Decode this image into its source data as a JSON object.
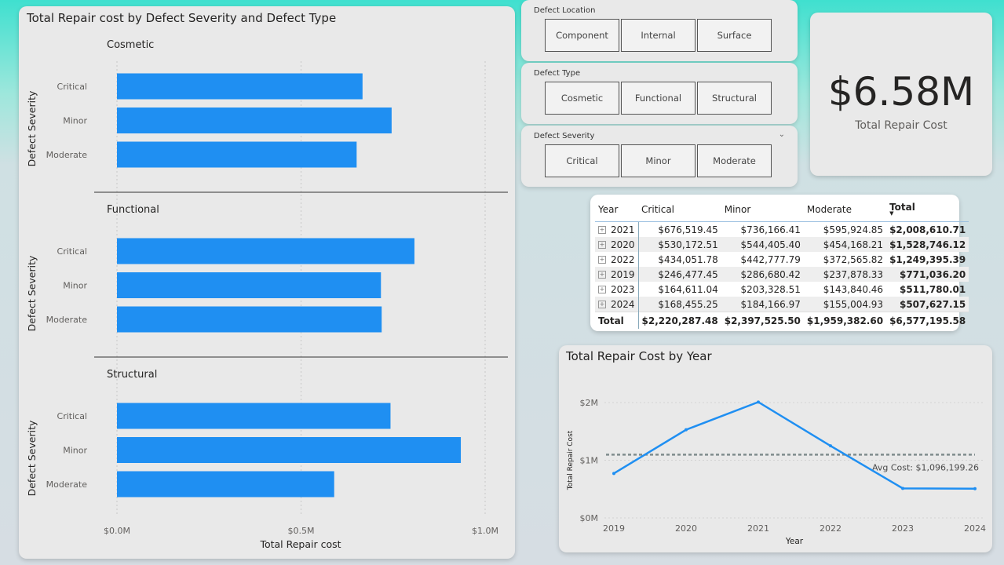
{
  "bar_card": {
    "title": "Total Repair cost by Defect Severity and Defect Type"
  },
  "slicers": {
    "location": {
      "title": "Defect Location",
      "options": [
        "Component",
        "Internal",
        "Surface"
      ]
    },
    "type": {
      "title": "Defect Type",
      "options": [
        "Cosmetic",
        "Functional",
        "Structural"
      ]
    },
    "severity": {
      "title": "Defect Severity",
      "options": [
        "Critical",
        "Minor",
        "Moderate"
      ]
    }
  },
  "kpi": {
    "value": "$6.58M",
    "label": "Total Repair Cost"
  },
  "matrix": {
    "headers": [
      "Year",
      "Critical",
      "Minor",
      "Moderate",
      "Total"
    ],
    "rows": [
      {
        "year": "2021",
        "critical": "$676,519.45",
        "minor": "$736,166.41",
        "moderate": "$595,924.85",
        "total": "$2,008,610.71"
      },
      {
        "year": "2020",
        "critical": "$530,172.51",
        "minor": "$544,405.40",
        "moderate": "$454,168.21",
        "total": "$1,528,746.12"
      },
      {
        "year": "2022",
        "critical": "$434,051.78",
        "minor": "$442,777.79",
        "moderate": "$372,565.82",
        "total": "$1,249,395.39"
      },
      {
        "year": "2019",
        "critical": "$246,477.45",
        "minor": "$286,680.42",
        "moderate": "$237,878.33",
        "total": "$771,036.20"
      },
      {
        "year": "2023",
        "critical": "$164,611.04",
        "minor": "$203,328.51",
        "moderate": "$143,840.46",
        "total": "$511,780.01"
      },
      {
        "year": "2024",
        "critical": "$168,455.25",
        "minor": "$184,166.97",
        "moderate": "$155,004.93",
        "total": "$507,627.15"
      }
    ],
    "grand": {
      "year": "Total",
      "critical": "$2,220,287.48",
      "minor": "$2,397,525.50",
      "moderate": "$1,959,382.60",
      "total": "$6,577,195.58"
    }
  },
  "line_card": {
    "title": "Total Repair Cost by Year"
  },
  "chart_data": [
    {
      "type": "bar",
      "orientation": "horizontal",
      "title": "Total Repair cost by Defect Severity and Defect Type",
      "xlabel": "Total Repair cost",
      "ylabel": "Defect Severity",
      "xlim": [
        0,
        1000000
      ],
      "x_ticks": [
        "$0.0M",
        "$0.5M",
        "$1.0M"
      ],
      "color": "#1f8ff2",
      "categories": [
        "Critical",
        "Minor",
        "Moderate"
      ],
      "panels": [
        {
          "name": "Cosmetic",
          "values": [
            667000,
            746000,
            651000
          ]
        },
        {
          "name": "Functional",
          "values": [
            808000,
            717000,
            719000
          ]
        },
        {
          "name": "Structural",
          "values": [
            743000,
            934000,
            590000
          ]
        }
      ]
    },
    {
      "type": "line",
      "title": "Total Repair Cost by Year",
      "xlabel": "Year",
      "ylabel": "Total Repair Cost",
      "x": [
        2019,
        2020,
        2021,
        2022,
        2023,
        2024
      ],
      "y": [
        771036.2,
        1528746.12,
        2008610.71,
        1249395.39,
        511780.01,
        507627.15
      ],
      "ylim": [
        0,
        2000000
      ],
      "y_ticks": [
        "$0M",
        "$1M",
        "$2M"
      ],
      "color": "#1f8ff2",
      "reference_line": {
        "label": "Avg Cost: $1,096,199.26",
        "value": 1096199.26,
        "color": "#7f8c8d"
      }
    }
  ]
}
